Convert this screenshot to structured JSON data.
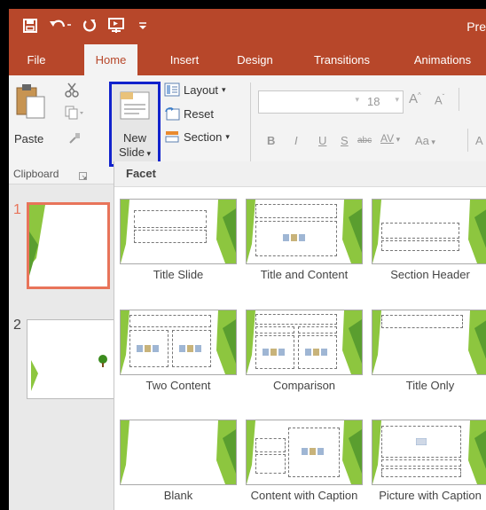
{
  "titlebar": {
    "title": "Pre"
  },
  "quick_access": [
    "save-icon",
    "undo-icon",
    "redo-icon",
    "start-from-beginning-icon",
    "customize-icon"
  ],
  "tabs": [
    {
      "label": "File"
    },
    {
      "label": "Home"
    },
    {
      "label": "Insert"
    },
    {
      "label": "Design"
    },
    {
      "label": "Transitions"
    },
    {
      "label": "Animations"
    }
  ],
  "ribbon": {
    "paste_label": "Paste",
    "new_slide_line1": "New",
    "new_slide_line2": "Slide",
    "layout_label": "Layout",
    "reset_label": "Reset",
    "section_label": "Section",
    "font_size": "18",
    "clipboard_group": "Clipboard",
    "bold": "B",
    "italic": "I",
    "underline": "U",
    "shadow": "S",
    "strike": "abc",
    "spacing": "AV",
    "case": "Aa"
  },
  "slides": [
    {
      "number": "1"
    },
    {
      "number": "2"
    }
  ],
  "gallery": {
    "title": "Facet",
    "layouts": [
      {
        "label": "Title Slide"
      },
      {
        "label": "Title and Content"
      },
      {
        "label": "Section Header"
      },
      {
        "label": "Two Content"
      },
      {
        "label": "Comparison"
      },
      {
        "label": "Title Only"
      },
      {
        "label": "Blank"
      },
      {
        "label": "Content with Caption"
      },
      {
        "label": "Picture with Caption"
      }
    ]
  },
  "colors": {
    "accent": "#b7472a",
    "theme_green": "#8dc63f",
    "highlight": "#1122cc",
    "selected_slide": "#e8745a"
  }
}
